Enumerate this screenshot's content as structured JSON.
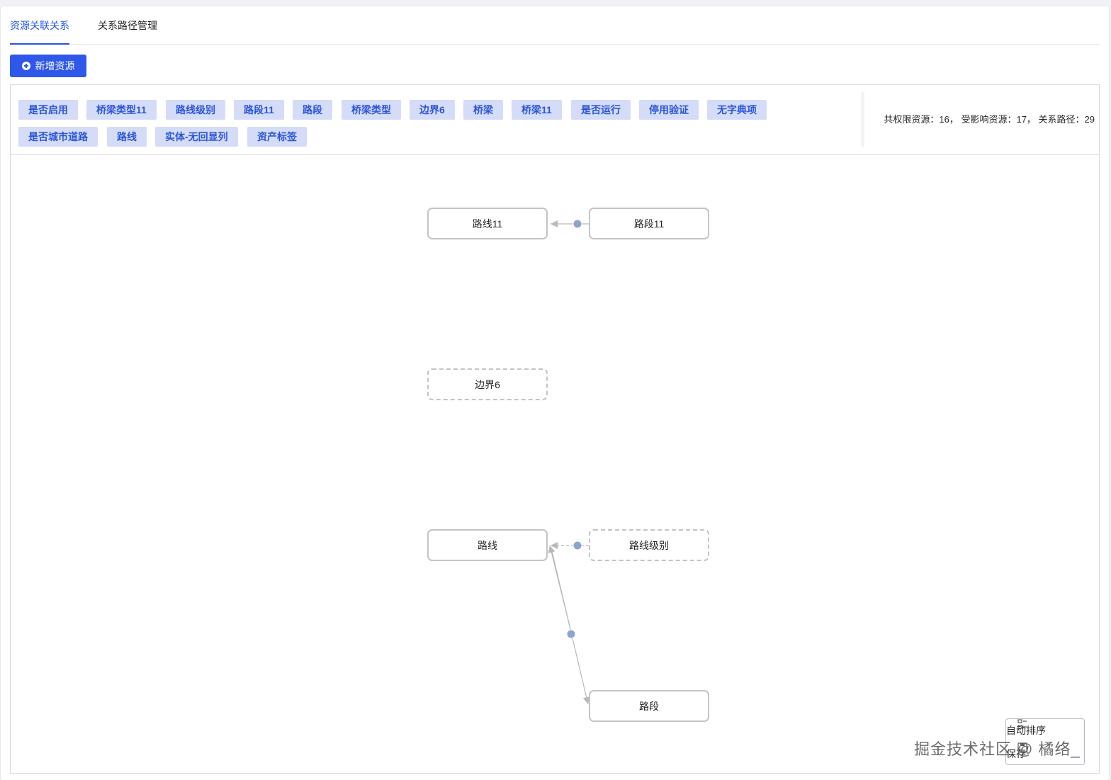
{
  "tabs": [
    {
      "label": "资源关联关系",
      "active": true
    },
    {
      "label": "关系路径管理",
      "active": false
    }
  ],
  "add_button": {
    "label": "新增资源",
    "icon": "plus-circle-icon"
  },
  "tags": [
    "是否启用",
    "桥梁类型11",
    "路线级别",
    "路段11",
    "路段",
    "桥梁类型",
    "边界6",
    "桥梁",
    "桥梁11",
    "是否运行",
    "停用验证",
    "无字典项",
    "是否城市道路",
    "路线",
    "实体-无回显列",
    "资产标签"
  ],
  "stats": {
    "text": "共权限资源：16， 受影响资源：17， 关系路径：29"
  },
  "graph": {
    "nodes": [
      {
        "id": "n1",
        "label": "路线11",
        "dashed": false
      },
      {
        "id": "n2",
        "label": "路段11",
        "dashed": false
      },
      {
        "id": "n3",
        "label": "边界6",
        "dashed": true
      },
      {
        "id": "n4",
        "label": "路线",
        "dashed": false
      },
      {
        "id": "n5",
        "label": "路线级别",
        "dashed": true
      },
      {
        "id": "n6",
        "label": "路段",
        "dashed": false
      }
    ],
    "edges": [
      {
        "from": "路段11",
        "to": "路线11"
      },
      {
        "from": "路线级别",
        "to": "路线"
      },
      {
        "from": "路线",
        "to": "路段"
      }
    ]
  },
  "toolbar": {
    "auto_sort_label": "自动排序",
    "second_label": "保存"
  },
  "watermark": "掘金技术社区 @ 橘络_",
  "colors": {
    "primary": "#2f57ea",
    "tag_bg": "#d4dcf7",
    "tag_text": "#2b55d9",
    "node_border": "#c4c4c4",
    "edge_handle": "#8fa3d1"
  }
}
